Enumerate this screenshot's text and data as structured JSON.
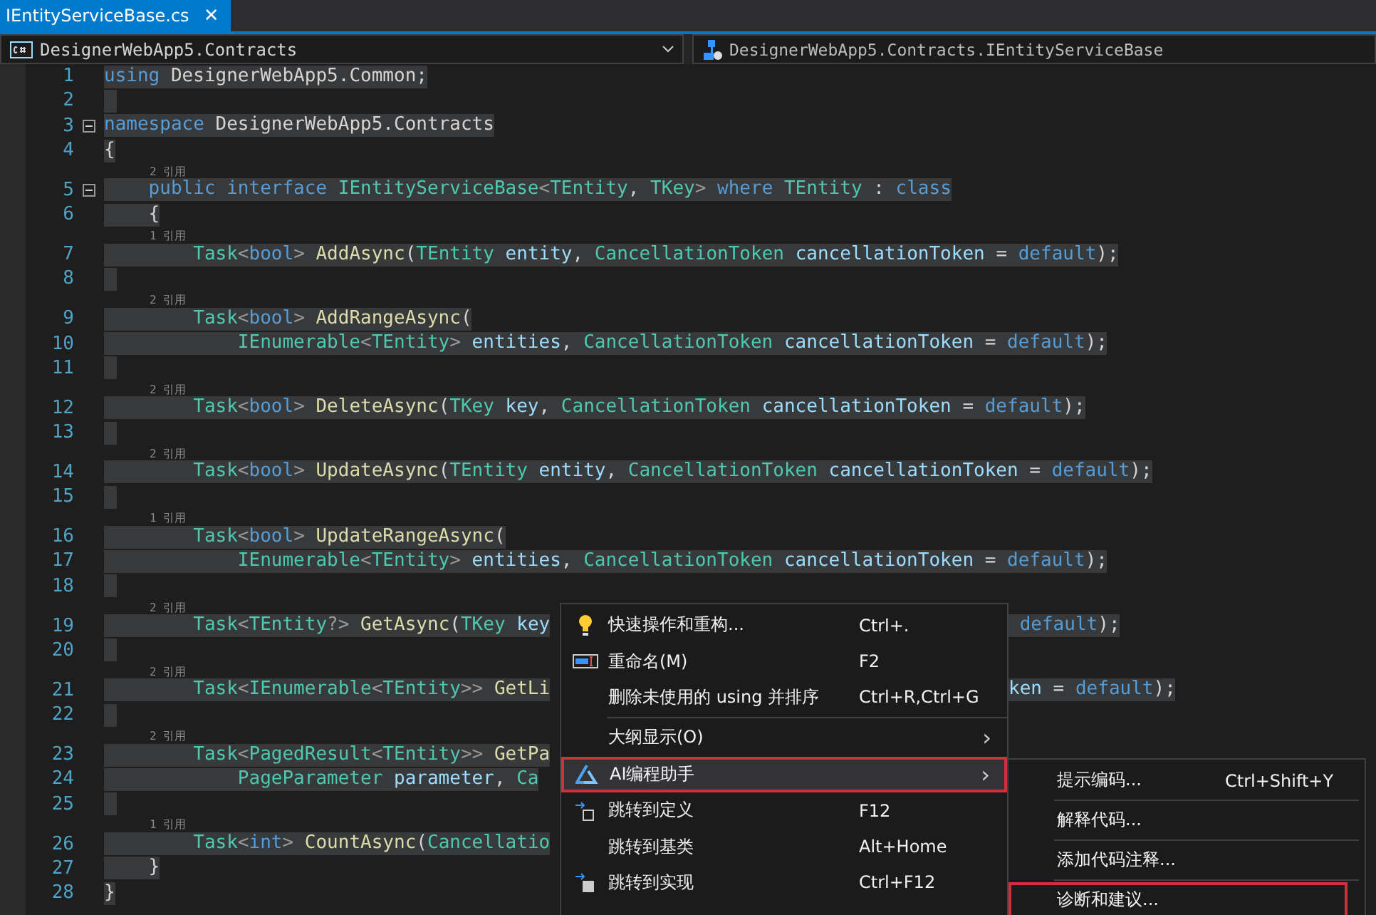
{
  "tabs": [
    {
      "label": "IEntityServiceBase.cs",
      "selected": true,
      "close": "✕"
    }
  ],
  "navigation": {
    "scope": "DesignerWebApp5.Contracts",
    "member": "DesignerWebApp5.Contracts.IEntityServiceBase"
  },
  "lines": [
    {
      "number": "1",
      "selected": true,
      "tokens": [
        {
          "kind": "keyword",
          "text": "using"
        },
        {
          "kind": "plain",
          "text": " DesignerWebApp5.Common;"
        }
      ]
    },
    {
      "number": "2",
      "selected": true
    },
    {
      "number": "3",
      "selected": true,
      "expanded": true,
      "tokens": [
        {
          "kind": "keyword",
          "text": "namespace"
        },
        {
          "kind": "plain",
          "text": " DesignerWebApp5.Contracts"
        }
      ]
    },
    {
      "number": "4",
      "selected": true,
      "tokens": [
        {
          "kind": "plain",
          "text": "{"
        }
      ]
    },
    {
      "number": "5",
      "selected": true,
      "expanded": true,
      "refs": "2 引用",
      "tokens": [
        {
          "kind": "keyword",
          "text": "    public interface "
        },
        {
          "kind": "type",
          "text": "IEntityServiceBase"
        },
        {
          "kind": "punct",
          "text": "<"
        },
        {
          "kind": "type",
          "text": "TEntity"
        },
        {
          "kind": "plain",
          "text": ", "
        },
        {
          "kind": "type",
          "text": "TKey"
        },
        {
          "kind": "punct",
          "text": "> "
        },
        {
          "kind": "keyword",
          "text": "where "
        },
        {
          "kind": "type",
          "text": "TEntity"
        },
        {
          "kind": "plain",
          "text": " : "
        },
        {
          "kind": "keyword",
          "text": "class"
        }
      ]
    },
    {
      "number": "6",
      "selected": true,
      "tokens": [
        {
          "kind": "plain",
          "text": "    {"
        }
      ]
    },
    {
      "number": "7",
      "selected": true,
      "refs": "1 引用",
      "tokens": [
        {
          "kind": "type",
          "text": "        Task"
        },
        {
          "kind": "punct",
          "text": "<"
        },
        {
          "kind": "keyword",
          "text": "bool"
        },
        {
          "kind": "punct",
          "text": "> "
        },
        {
          "kind": "method",
          "text": "AddAsync"
        },
        {
          "kind": "plain",
          "text": "("
        },
        {
          "kind": "type",
          "text": "TEntity "
        },
        {
          "kind": "parameter",
          "text": "entity"
        },
        {
          "kind": "plain",
          "text": ", "
        },
        {
          "kind": "type",
          "text": "CancellationToken "
        },
        {
          "kind": "parameter",
          "text": "cancellationToken"
        },
        {
          "kind": "plain",
          "text": " = "
        },
        {
          "kind": "keyword",
          "text": "default"
        },
        {
          "kind": "plain",
          "text": ");"
        }
      ]
    },
    {
      "number": "8",
      "selected": true
    },
    {
      "number": "9",
      "selected": true,
      "refs": "2 引用",
      "tokens": [
        {
          "kind": "type",
          "text": "        Task"
        },
        {
          "kind": "punct",
          "text": "<"
        },
        {
          "kind": "keyword",
          "text": "bool"
        },
        {
          "kind": "punct",
          "text": "> "
        },
        {
          "kind": "method",
          "text": "AddRangeAsync"
        },
        {
          "kind": "plain",
          "text": "("
        }
      ]
    },
    {
      "number": "10",
      "selected": true,
      "tokens": [
        {
          "kind": "type",
          "text": "            IEnumerable"
        },
        {
          "kind": "punct",
          "text": "<"
        },
        {
          "kind": "type",
          "text": "TEntity"
        },
        {
          "kind": "punct",
          "text": "> "
        },
        {
          "kind": "parameter",
          "text": "entities"
        },
        {
          "kind": "plain",
          "text": ", "
        },
        {
          "kind": "type",
          "text": "CancellationToken "
        },
        {
          "kind": "parameter",
          "text": "cancellationToken"
        },
        {
          "kind": "plain",
          "text": " = "
        },
        {
          "kind": "keyword",
          "text": "default"
        },
        {
          "kind": "plain",
          "text": ");"
        }
      ]
    },
    {
      "number": "11",
      "selected": true
    },
    {
      "number": "12",
      "selected": true,
      "refs": "2 引用",
      "tokens": [
        {
          "kind": "type",
          "text": "        Task"
        },
        {
          "kind": "punct",
          "text": "<"
        },
        {
          "kind": "keyword",
          "text": "bool"
        },
        {
          "kind": "punct",
          "text": "> "
        },
        {
          "kind": "method",
          "text": "DeleteAsync"
        },
        {
          "kind": "plain",
          "text": "("
        },
        {
          "kind": "type",
          "text": "TKey "
        },
        {
          "kind": "parameter",
          "text": "key"
        },
        {
          "kind": "plain",
          "text": ", "
        },
        {
          "kind": "type",
          "text": "CancellationToken "
        },
        {
          "kind": "parameter",
          "text": "cancellationToken"
        },
        {
          "kind": "plain",
          "text": " = "
        },
        {
          "kind": "keyword",
          "text": "default"
        },
        {
          "kind": "plain",
          "text": ");"
        }
      ]
    },
    {
      "number": "13",
      "selected": true
    },
    {
      "number": "14",
      "selected": true,
      "refs": "2 引用",
      "tokens": [
        {
          "kind": "type",
          "text": "        Task"
        },
        {
          "kind": "punct",
          "text": "<"
        },
        {
          "kind": "keyword",
          "text": "bool"
        },
        {
          "kind": "punct",
          "text": "> "
        },
        {
          "kind": "method",
          "text": "UpdateAsync"
        },
        {
          "kind": "plain",
          "text": "("
        },
        {
          "kind": "type",
          "text": "TEntity "
        },
        {
          "kind": "parameter",
          "text": "entity"
        },
        {
          "kind": "plain",
          "text": ", "
        },
        {
          "kind": "type",
          "text": "CancellationToken "
        },
        {
          "kind": "parameter",
          "text": "cancellationToken"
        },
        {
          "kind": "plain",
          "text": " = "
        },
        {
          "kind": "keyword",
          "text": "default"
        },
        {
          "kind": "plain",
          "text": ");"
        }
      ]
    },
    {
      "number": "15",
      "selected": true
    },
    {
      "number": "16",
      "selected": true,
      "refs": "1 引用",
      "tokens": [
        {
          "kind": "type",
          "text": "        Task"
        },
        {
          "kind": "punct",
          "text": "<"
        },
        {
          "kind": "keyword",
          "text": "bool"
        },
        {
          "kind": "punct",
          "text": "> "
        },
        {
          "kind": "method",
          "text": "UpdateRangeAsync"
        },
        {
          "kind": "plain",
          "text": "("
        }
      ]
    },
    {
      "number": "17",
      "selected": true,
      "tokens": [
        {
          "kind": "type",
          "text": "            IEnumerable"
        },
        {
          "kind": "punct",
          "text": "<"
        },
        {
          "kind": "type",
          "text": "TEntity"
        },
        {
          "kind": "punct",
          "text": "> "
        },
        {
          "kind": "parameter",
          "text": "entities"
        },
        {
          "kind": "plain",
          "text": ", "
        },
        {
          "kind": "type",
          "text": "CancellationToken "
        },
        {
          "kind": "parameter",
          "text": "cancellationToken"
        },
        {
          "kind": "plain",
          "text": " = "
        },
        {
          "kind": "keyword",
          "text": "default"
        },
        {
          "kind": "plain",
          "text": ");"
        }
      ]
    },
    {
      "number": "18",
      "selected": true
    },
    {
      "number": "19",
      "selected": true,
      "refs": "2 引用",
      "tokens": [
        {
          "kind": "type",
          "text": "        Task"
        },
        {
          "kind": "punct",
          "text": "<"
        },
        {
          "kind": "type",
          "text": "TEntity"
        },
        {
          "kind": "punct",
          "text": "?> "
        },
        {
          "kind": "method",
          "text": "GetAsync"
        },
        {
          "kind": "plain",
          "text": "("
        },
        {
          "kind": "type",
          "text": "TKey "
        },
        {
          "kind": "parameter",
          "text": "key"
        }
      ],
      "tail": [
        {
          "kind": "keyword",
          "text": " default"
        },
        {
          "kind": "plain",
          "text": ");"
        }
      ]
    },
    {
      "number": "20",
      "selected": true
    },
    {
      "number": "21",
      "selected": true,
      "refs": "2 引用",
      "tokens": [
        {
          "kind": "type",
          "text": "        Task"
        },
        {
          "kind": "punct",
          "text": "<"
        },
        {
          "kind": "type",
          "text": "IEnumerable"
        },
        {
          "kind": "punct",
          "text": "<"
        },
        {
          "kind": "type",
          "text": "TEntity"
        },
        {
          "kind": "punct",
          "text": ">> "
        },
        {
          "kind": "method",
          "text": "GetLi"
        }
      ],
      "tail": [
        {
          "kind": "parameter",
          "text": "ken"
        },
        {
          "kind": "plain",
          "text": " = "
        },
        {
          "kind": "keyword",
          "text": "default"
        },
        {
          "kind": "plain",
          "text": ");"
        }
      ]
    },
    {
      "number": "22",
      "selected": true
    },
    {
      "number": "23",
      "selected": true,
      "refs": "2 引用",
      "tokens": [
        {
          "kind": "type",
          "text": "        Task"
        },
        {
          "kind": "punct",
          "text": "<"
        },
        {
          "kind": "type",
          "text": "PagedResult"
        },
        {
          "kind": "punct",
          "text": "<"
        },
        {
          "kind": "type",
          "text": "TEntity"
        },
        {
          "kind": "punct",
          "text": ">> "
        },
        {
          "kind": "method",
          "text": "GetPa"
        }
      ]
    },
    {
      "number": "24",
      "selected": true,
      "tokens": [
        {
          "kind": "type",
          "text": "            PageParameter "
        },
        {
          "kind": "parameter",
          "text": "parameter"
        },
        {
          "kind": "plain",
          "text": ", "
        },
        {
          "kind": "type",
          "text": "Ca"
        }
      ]
    },
    {
      "number": "25",
      "selected": true
    },
    {
      "number": "26",
      "selected": true,
      "refs": "1 引用",
      "tokens": [
        {
          "kind": "type",
          "text": "        Task"
        },
        {
          "kind": "punct",
          "text": "<"
        },
        {
          "kind": "keyword",
          "text": "int"
        },
        {
          "kind": "punct",
          "text": "> "
        },
        {
          "kind": "method",
          "text": "CountAsync"
        },
        {
          "kind": "plain",
          "text": "("
        },
        {
          "kind": "type",
          "text": "Cancellatio"
        }
      ]
    },
    {
      "number": "27",
      "selected": true,
      "tokens": [
        {
          "kind": "plain",
          "text": "    }"
        }
      ]
    },
    {
      "number": "28",
      "selected": true,
      "tokens": [
        {
          "kind": "plain",
          "text": "}"
        }
      ]
    }
  ],
  "context_menu": [
    {
      "kind": "item",
      "label": "快速操作和重构...",
      "shortcut": "Ctrl+.",
      "selected": false
    },
    {
      "kind": "item",
      "label": "重命名(M)",
      "shortcut": "F2",
      "selected": false
    },
    {
      "kind": "item",
      "label": "删除未使用的 using 并排序",
      "shortcut": "Ctrl+R,Ctrl+G",
      "selected": false
    },
    {
      "kind": "separator"
    },
    {
      "kind": "item",
      "label": "大纲显示(O)",
      "selected": false,
      "arrow": "›"
    },
    {
      "kind": "item",
      "label": "AI编程助手",
      "selected": true,
      "arrow": "›"
    },
    {
      "kind": "item",
      "label": "跳转到定义",
      "shortcut": "F12",
      "selected": false
    },
    {
      "kind": "item",
      "label": "跳转到基类",
      "shortcut": "Alt+Home",
      "selected": false
    },
    {
      "kind": "item",
      "label": "跳转到实现",
      "shortcut": "Ctrl+F12",
      "selected": false
    }
  ],
  "submenu": [
    {
      "label": "提示编码...",
      "shortcut": "Ctrl+Shift+Y",
      "highlighted": false
    },
    {
      "label": "解释代码...",
      "highlighted": false
    },
    {
      "label": "添加代码注释...",
      "highlighted": false
    },
    {
      "label": "诊断和建议...",
      "highlighted": true
    }
  ]
}
